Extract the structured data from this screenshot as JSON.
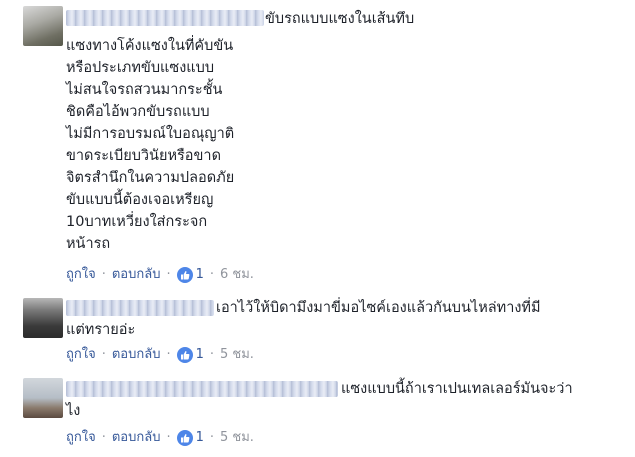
{
  "comments": [
    {
      "text_lines": [
        "ขับรถแบบแซงในเส้นทึบ",
        "แซงทางโค้งแซงในที่คับขัน",
        "หรือประเภทขับแซงแบบ",
        "ไม่สนใจรถสวนมากระชั้น",
        "ชิดคือไอ้พวกขับรถแบบ",
        "ไม่มีการอบรมณ์ใบอณุญาติ",
        "ขาดระเบียบวินัยหรือขาด",
        "จิตรสำนึกในความปลอดภัย",
        "ขับแบบนี้ต้องเจอเหรียญ",
        "10บาทเหวี่ยงใส่กระจก",
        "หน้ารถ"
      ],
      "actions": {
        "like": "ถูกใจ",
        "reply": "ตอบกลับ",
        "separator": "·",
        "like_count": "1",
        "time": "6 ชม."
      }
    },
    {
      "text_lines": [
        "เอาไว้ให้บิดามึงมาขี่มอไซค์เองแล้วกันบนไหล่ทางที่มี",
        "แต่ทรายอ่ะ"
      ],
      "actions": {
        "like": "ถูกใจ",
        "reply": "ตอบกลับ",
        "separator": "·",
        "like_count": "1",
        "time": "5 ชม."
      }
    },
    {
      "text_lines": [
        "แซงแบบนี้ถ้าเราเปนเทลเลอร์มันจะว่า",
        "ไง"
      ],
      "actions": {
        "like": "ถูกใจ",
        "reply": "ตอบกลับ",
        "separator": "·",
        "like_count": "1",
        "time": "5 ชม."
      }
    }
  ],
  "icons": {
    "like": "thumbs-up-icon",
    "like_badge_color": "#4e86e8",
    "link_color": "#365899",
    "meta_color": "#90949c"
  }
}
